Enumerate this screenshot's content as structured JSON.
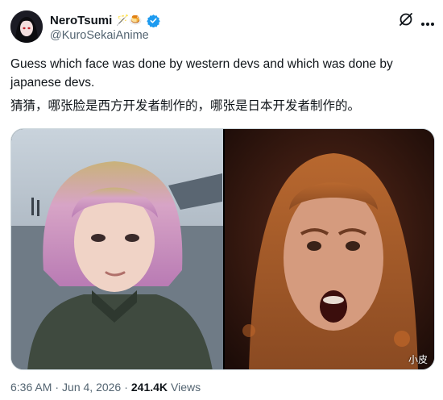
{
  "author": {
    "display_name": "NeroTsumi",
    "name_emoji": "🪄🍮",
    "handle": "@KuroSekaiAnime",
    "verified": true
  },
  "post": {
    "text_en": "Guess which face was done by western devs and which was done by japanese devs.",
    "text_zh": "猜猜，哪张脸是西方开发者制作的，哪张是日本开发者制作的。"
  },
  "media": {
    "left_image": "anime-style-girl-pink-hair-face",
    "right_image": "western-style-woman-red-hair-face",
    "watermark": "小皮"
  },
  "meta": {
    "time": "6:36 AM",
    "separator": "·",
    "date": "Jun 4, 2026",
    "views_count": "241.4K",
    "views_label": "Views"
  },
  "icons": {
    "grok": "grok-icon",
    "more": "more-options-icon",
    "verified": "verified-badge-icon"
  },
  "colors": {
    "text_primary": "#0f1419",
    "text_secondary": "#536471",
    "verified_blue": "#1d9bf0",
    "border": "#cfd9de"
  }
}
